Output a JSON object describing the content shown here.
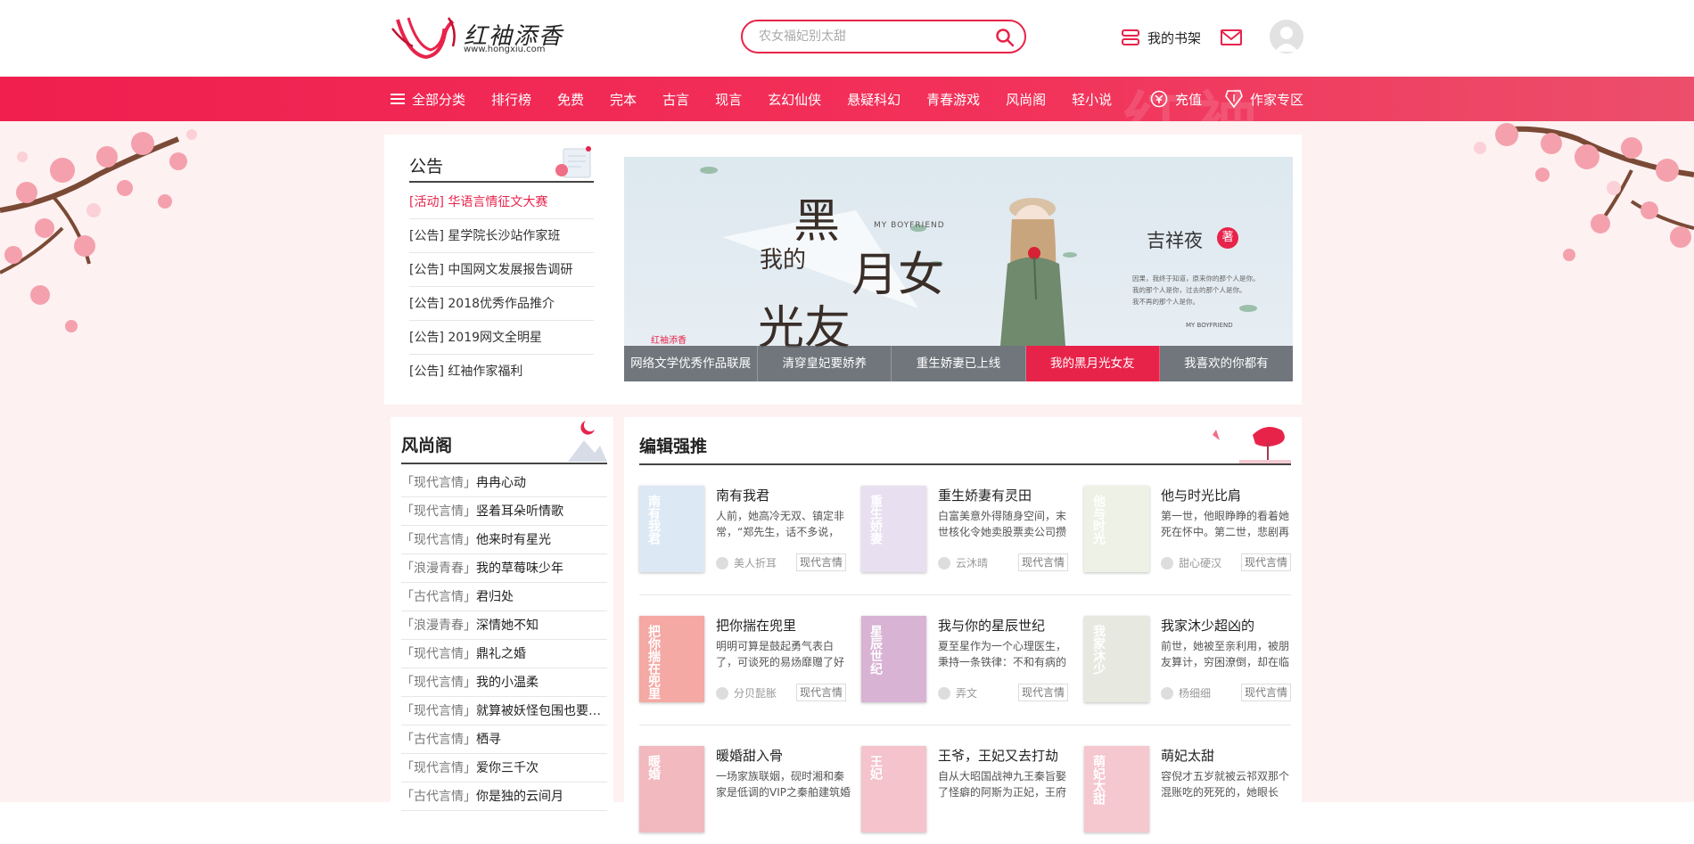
{
  "brand": {
    "logo_text": "红袖添香",
    "url": "www.hongxiu.com"
  },
  "search": {
    "placeholder": "农女福妃别太甜"
  },
  "header": {
    "shelf_label": "我的书架"
  },
  "nav": {
    "all_label": "全部分类",
    "items": [
      "排行榜",
      "免费",
      "完本",
      "古言",
      "现言",
      "玄幻仙侠",
      "悬疑科幻",
      "青春游戏",
      "风尚阁",
      "轻小说"
    ],
    "recharge_label": "充值",
    "author_label": "作家专区",
    "deco_text": "红袖"
  },
  "notice": {
    "title": "公告",
    "items": [
      "[活动] 华语言情征文大赛",
      "[公告] 星学院长沙站作家班",
      "[公告] 中国网文发展报告调研",
      "[公告] 2018优秀作品推介",
      "[公告] 2019网文全明星",
      "[公告] 红袖作家福利"
    ]
  },
  "banner": {
    "title_1": "黑",
    "title_2": "月女",
    "title_3": "光友",
    "title_my": "我的",
    "en_text": "MY BOYFRIEND",
    "author": "吉祥夜",
    "author_suffix": "著",
    "blurb_1": "因果，我终于知道，原来你的那个人是你。",
    "blurb_2": "我的那个人是你，过去的那个人是你。",
    "blurb_3": "我不再的那个人是你。",
    "logo": "红袖添香",
    "tabs": [
      "网络文学优秀作品联展",
      "清穿皇妃要娇养",
      "重生娇妻已上线",
      "我的黑月光女友",
      "我喜欢的你都有"
    ],
    "active_tab": 3
  },
  "fengshangge": {
    "title": "风尚阁",
    "items": [
      {
        "cat": "「现代言情」",
        "name": "冉冉心动"
      },
      {
        "cat": "「现代言情」",
        "name": "竖着耳朵听情歌"
      },
      {
        "cat": "「现代言情」",
        "name": "他来时有星光"
      },
      {
        "cat": "「浪漫青春」",
        "name": "我的草莓味少年"
      },
      {
        "cat": "「古代言情」",
        "name": "君归处"
      },
      {
        "cat": "「浪漫青春」",
        "name": "深情她不知"
      },
      {
        "cat": "「现代言情」",
        "name": "鼎礼之婚"
      },
      {
        "cat": "「现代言情」",
        "name": "我的小温柔"
      },
      {
        "cat": "「现代言情」",
        "name": "就算被妖怪包围也要谈恋爱"
      },
      {
        "cat": "「古代言情」",
        "name": "栖寻"
      },
      {
        "cat": "「现代言情」",
        "name": "爱你三千次"
      },
      {
        "cat": "「古代言情」",
        "name": "你是独的云间月"
      }
    ]
  },
  "editor_picks": {
    "title": "编辑强推",
    "books": [
      {
        "title": "南有我君",
        "desc": "人前，她高冷无双、镇定非常，“郑先生，话不多说，",
        "author": "美人折耳",
        "tag": "现代言情",
        "cover_text": "南有我君",
        "cover_color": "#dce9f4"
      },
      {
        "title": "重生娇妻有灵田",
        "desc": "白富美意外得随身空间，末世核化令她卖股票卖公司攒",
        "author": "云沐晴",
        "tag": "现代言情",
        "cover_text": "重生娇妻",
        "cover_color": "#e8dff0"
      },
      {
        "title": "他与时光比肩",
        "desc": "第一世，他眼睁睁的看着她死在怀中。第二世，悲剧再",
        "author": "甜心硬汉",
        "tag": "现代言情",
        "cover_text": "他与时光",
        "cover_color": "#eef2e6"
      },
      {
        "title": "把你揣在兜里",
        "desc": "明明可算是鼓起勇气表白了，可谈死的易炀靡赠了好",
        "author": "分贝髭胀",
        "tag": "现代言情",
        "cover_text": "把你揣在兜里",
        "cover_color": "#f4a9a4"
      },
      {
        "title": "我与你的星辰世纪",
        "desc": "夏至星作为一个心理医生，秉持一条铁律：不和有病的",
        "author": "弄文",
        "tag": "现代言情",
        "cover_text": "星辰世纪",
        "cover_color": "#d8b3d4"
      },
      {
        "title": "我家沐少超凶的",
        "desc": "前世，她被至亲利用，被朋友算计，穷困潦倒，却在临",
        "author": "杨细细",
        "tag": "现代言情",
        "cover_text": "我家沐少",
        "cover_color": "#e7e9e0"
      },
      {
        "title": "暖婚甜入骨",
        "desc": "一场家族联姻，砚时湘和秦家是低调的VIP之秦舶建筑婚",
        "author": "",
        "tag": "",
        "cover_text": "暖婚",
        "cover_color": "#f2b9bf"
      },
      {
        "title": "王爷，王妃又去打劫",
        "desc": "自从大昭国战神九王秦旨娶了怪癖的阿斯为正妃，王府",
        "author": "",
        "tag": "",
        "cover_text": "王妃",
        "cover_color": "#f4c3cc"
      },
      {
        "title": "萌妃太甜",
        "desc": "容倪才五岁就被云祁双那个混账吃的死死的，她眼长",
        "author": "",
        "tag": "",
        "cover_text": "萌妃太甜",
        "cover_color": "#f5c7cf"
      }
    ]
  },
  "colors": {
    "accent": "#e8234a",
    "bg": "#fdf1f1"
  }
}
